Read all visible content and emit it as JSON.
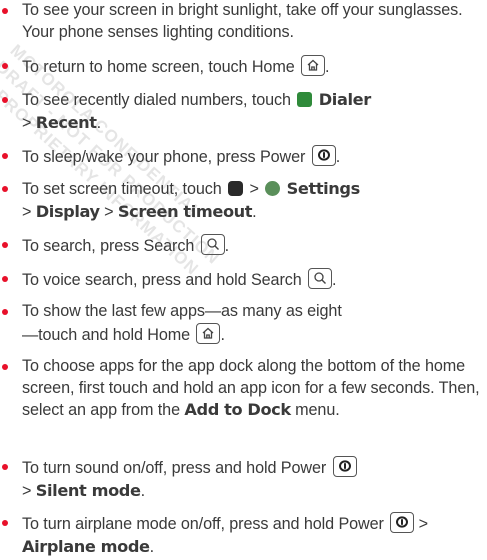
{
  "colors": {
    "bullet": "#e8102a",
    "text": "#3a3a3a",
    "dialer_icon": "#2f8a3a",
    "launcher_icon": "#2a2a2a",
    "settings_icon": "#5a8f5a"
  },
  "watermark": {
    "line1": "MOTOROLA CONFIDENTIAL",
    "line2": "DRAFT - NOT FOR PRODUCTION",
    "line3": "& PROPRIETARY INFORMATION"
  },
  "items": [
    {
      "t1": "To see your screen in bright sunlight, take off your sunglasses. Your phone senses lighting conditions."
    },
    {
      "t1": "To return to home screen, touch Home",
      "key": "home-icon",
      "t2": "."
    },
    {
      "t1": "To see recently dialed numbers, touch",
      "b1": "Dialer",
      "sep": ">",
      "b2": "Recent",
      "end": "."
    },
    {
      "t1": "To sleep/wake your phone, press Power",
      "key": "power-icon",
      "t2": "."
    },
    {
      "t1": "To set screen timeout, touch",
      "sep1": ">",
      "b1": "Settings",
      "sep2": ">",
      "b2": "Display",
      "sep3": ">",
      "b3": "Screen timeout",
      "end": "."
    },
    {
      "t1": "To search, press Search",
      "key": "search-icon",
      "t2": "."
    },
    {
      "t1": "To voice search, press and hold Search",
      "key": "search-icon",
      "t2": "."
    },
    {
      "t1": "To show the last few apps—as many as eight—touch and hold Home",
      "key": "home-icon",
      "t2": "."
    },
    {
      "t1": "To choose apps for the app dock along the bottom of the home screen, first touch and hold an app icon for a few seconds. Then, select an app from the",
      "b1": "Add to Dock",
      "t2": "menu."
    },
    {
      "t1": "To turn sound on/off, press and hold Power",
      "key": "power-icon",
      "sep": ">",
      "b1": "Silent mode",
      "end": "."
    },
    {
      "t1": "To turn airplane mode on/off, press and hold Power",
      "key": "power-icon",
      "sep": ">",
      "b1": "Airplane mode",
      "end": "."
    }
  ]
}
